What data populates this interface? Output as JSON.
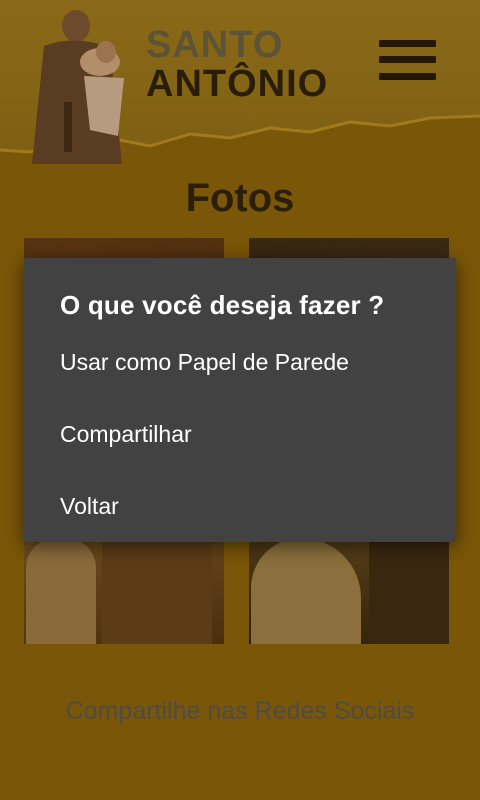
{
  "header": {
    "brand_line1": "SANTO",
    "brand_line2": "ANTÔNIO",
    "menu_icon": "hamburger-menu-icon"
  },
  "main": {
    "title": "Fotos",
    "photos": [
      {
        "name": "photo-1"
      },
      {
        "name": "photo-2"
      }
    ],
    "social_label": "Compartilhe nas Redes Sociais"
  },
  "dialog": {
    "title": "O que você deseja fazer ?",
    "options": [
      {
        "label": "Usar como Papel de Parede"
      },
      {
        "label": "Compartilhar"
      },
      {
        "label": "Voltar"
      }
    ]
  },
  "colors": {
    "background": "#7a5608",
    "dialog_background": "#424242",
    "dialog_text": "#ffffff"
  }
}
